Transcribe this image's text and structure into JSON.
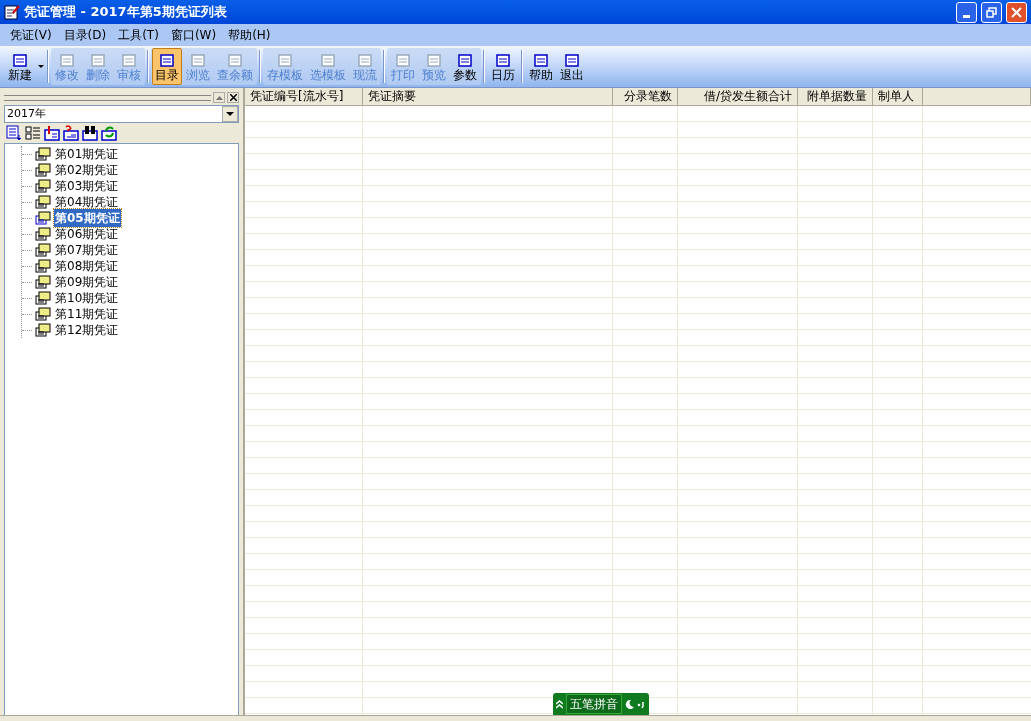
{
  "window": {
    "title": "凭证管理 - 2017年第5期凭证列表"
  },
  "menu": [
    {
      "label": "凭证(V)"
    },
    {
      "label": "目录(D)"
    },
    {
      "label": "工具(T)"
    },
    {
      "label": "窗口(W)"
    },
    {
      "label": "帮助(H)"
    }
  ],
  "toolbar": {
    "groups": [
      [
        {
          "label": "新建",
          "disabled": false,
          "selected": false,
          "dropdown": true
        }
      ],
      [
        {
          "label": "修改",
          "disabled": true,
          "selected": false
        },
        {
          "label": "删除",
          "disabled": true,
          "selected": false
        },
        {
          "label": "审核",
          "disabled": true,
          "selected": false
        }
      ],
      [
        {
          "label": "目录",
          "disabled": false,
          "selected": true
        },
        {
          "label": "浏览",
          "disabled": true,
          "selected": false
        },
        {
          "label": "查余额",
          "disabled": true,
          "selected": false
        }
      ],
      [
        {
          "label": "存模板",
          "disabled": true,
          "selected": false
        },
        {
          "label": "选模板",
          "disabled": true,
          "selected": false
        },
        {
          "label": "现流",
          "disabled": true,
          "selected": false
        }
      ],
      [
        {
          "label": "打印",
          "disabled": true,
          "selected": false
        },
        {
          "label": "预览",
          "disabled": true,
          "selected": false
        },
        {
          "label": "参数",
          "disabled": false,
          "selected": false
        }
      ],
      [
        {
          "label": "日历",
          "disabled": false,
          "selected": false
        }
      ],
      [
        {
          "label": "帮助",
          "disabled": false,
          "selected": false
        },
        {
          "label": "退出",
          "disabled": false,
          "selected": false
        }
      ]
    ]
  },
  "sidebar": {
    "year": "2017年",
    "items": [
      {
        "label": "第01期凭证",
        "selected": false
      },
      {
        "label": "第02期凭证",
        "selected": false
      },
      {
        "label": "第03期凭证",
        "selected": false
      },
      {
        "label": "第04期凭证",
        "selected": false
      },
      {
        "label": "第05期凭证",
        "selected": true
      },
      {
        "label": "第06期凭证",
        "selected": false
      },
      {
        "label": "第07期凭证",
        "selected": false
      },
      {
        "label": "第08期凭证",
        "selected": false
      },
      {
        "label": "第09期凭证",
        "selected": false
      },
      {
        "label": "第10期凭证",
        "selected": false
      },
      {
        "label": "第11期凭证",
        "selected": false
      },
      {
        "label": "第12期凭证",
        "selected": false
      }
    ]
  },
  "table": {
    "columns": [
      {
        "label": "凭证编号[流水号]"
      },
      {
        "label": "凭证摘要"
      },
      {
        "label": "分录笔数"
      },
      {
        "label": "借/贷发生额合计"
      },
      {
        "label": "附单据数量"
      },
      {
        "label": "制单人"
      }
    ]
  },
  "ime": {
    "label": "五笔拼音"
  }
}
